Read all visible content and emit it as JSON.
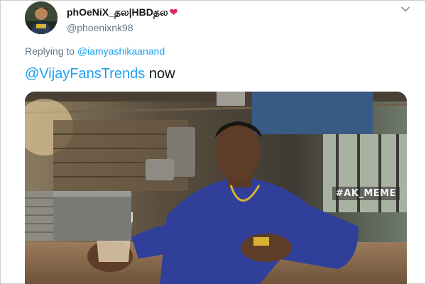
{
  "tweet": {
    "display_name": "phOeNiX_தல|HBDதல",
    "display_name_emoji": "❤",
    "handle": "@phoenixnk98",
    "replying_prefix": "Replying to",
    "replying_to": "@iamyashikaanand",
    "text_mention": "@VijayFansTrends",
    "text_rest": " now",
    "avatar_icon": "profile-photo",
    "more_icon": "chevron-down-icon"
  },
  "media": {
    "watermark": "#AK_MEME",
    "description_icon": "meme-photo"
  },
  "colors": {
    "link": "#1da1f2",
    "text": "#14171a",
    "secondary": "#657786",
    "heart": "#e0245e"
  }
}
